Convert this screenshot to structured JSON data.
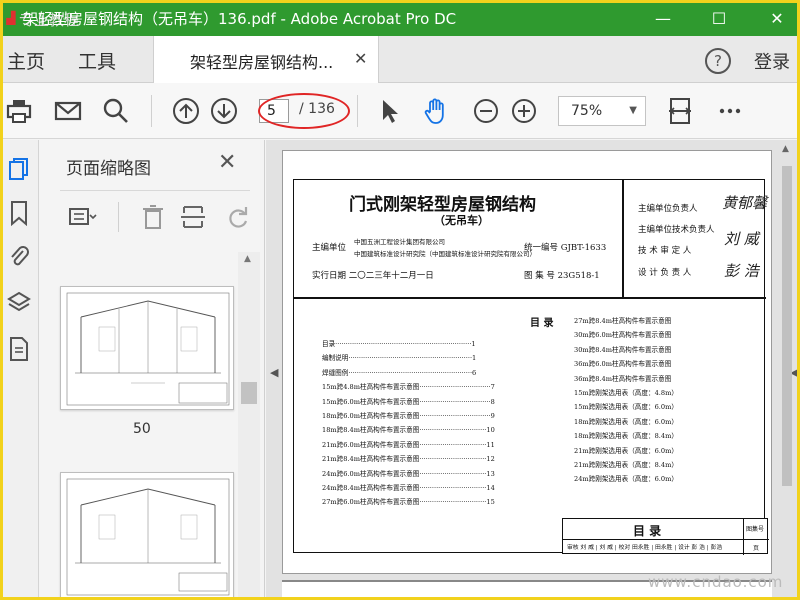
{
  "window": {
    "title": "架轻型房屋钢结构（无吊车）136.pdf - Adobe Acrobat Pro DC",
    "minimize": "—",
    "maximize": "☐",
    "close": "✕"
  },
  "tabs": {
    "home": "主页",
    "tools": "工具",
    "doc": "架轻型房屋钢结构...",
    "doc_close": "✕",
    "help": "?",
    "login": "登录"
  },
  "toolbar": {
    "page_current": "5",
    "page_total": "/ 136",
    "zoom": "75%",
    "icons": [
      "printer-icon",
      "email-icon",
      "search-icon",
      "page-up-icon",
      "page-down-icon",
      "select-cursor-icon",
      "hand-tool-icon",
      "zoom-out-icon",
      "zoom-in-icon",
      "fit-page-icon",
      "more-icon"
    ]
  },
  "panel": {
    "title": "页面缩略图",
    "close": "✕",
    "thumb_label": "50"
  },
  "document": {
    "cover": {
      "title": "门式刚架轻型房屋钢结构",
      "subtitle": "（无吊车）",
      "editor_label": "主编单位",
      "editor_1": "中国五洲工程设计集团有限公司",
      "editor_2": "中国建筑标准设计研究院（中国建筑标准设计研究院有限公司）",
      "unified_no": "统一编号 GJBT-1633",
      "date": "实行日期 二〇二三年十二月一日",
      "atlas_no": "图 集 号 23G518-1",
      "resp_1": "主编单位负责人",
      "resp_2": "主编单位技术负责人",
      "resp_3": "技 术 审 定 人",
      "resp_4": "设 计 负 责 人",
      "sig_1": "黄郁馨",
      "sig_2": "刘 威",
      "sig_3": "彭 浩"
    },
    "toc_heading": "目     录",
    "toc_left": [
      "目录·································································1",
      "编制说明···························································1",
      "焊缝图例···························································6",
      "15m跨4.8m柱高构件布置示意图··································7",
      "15m跨6.0m柱高构件布置示意图··································8",
      "18m跨6.0m柱高构件布置示意图··································9",
      "18m跨8.4m柱高构件布置示意图································10",
      "21m跨6.0m柱高构件布置示意图································11",
      "21m跨8.4m柱高构件布置示意图································12",
      "24m跨6.0m柱高构件布置示意图································13",
      "24m跨8.4m柱高构件布置示意图································14",
      "27m跨6.0m柱高构件布置示意图································15"
    ],
    "toc_right": [
      "27m跨8.4m柱高构件布置示意图",
      "30m跨6.0m柱高构件布置示意图",
      "30m跨8.4m柱高构件布置示意图",
      "36m跨6.0m柱高构件布置示意图",
      "36m跨8.4m柱高构件布置示意图",
      "15m跨刚架选用表（高度：4.8m）",
      "15m跨刚架选用表（高度：6.0m）",
      "18m跨刚架选用表（高度：6.0m）",
      "18m跨刚架选用表（高度：8.4m）",
      "21m跨刚架选用表（高度：6.0m）",
      "21m跨刚架选用表（高度：8.4m）",
      "24m跨刚架选用表（高度：6.0m）"
    ],
    "titleblock": {
      "name": "目     录",
      "atlas_label": "图集号",
      "page_label": "页",
      "row": "审核 刘 威 | 刘 威 | 校对 田永胜 | 田永胜 | 设计 彭 浩 | 彭浩"
    }
  },
  "watermark": "www.cndao.com",
  "top_watermark": "专业教程"
}
